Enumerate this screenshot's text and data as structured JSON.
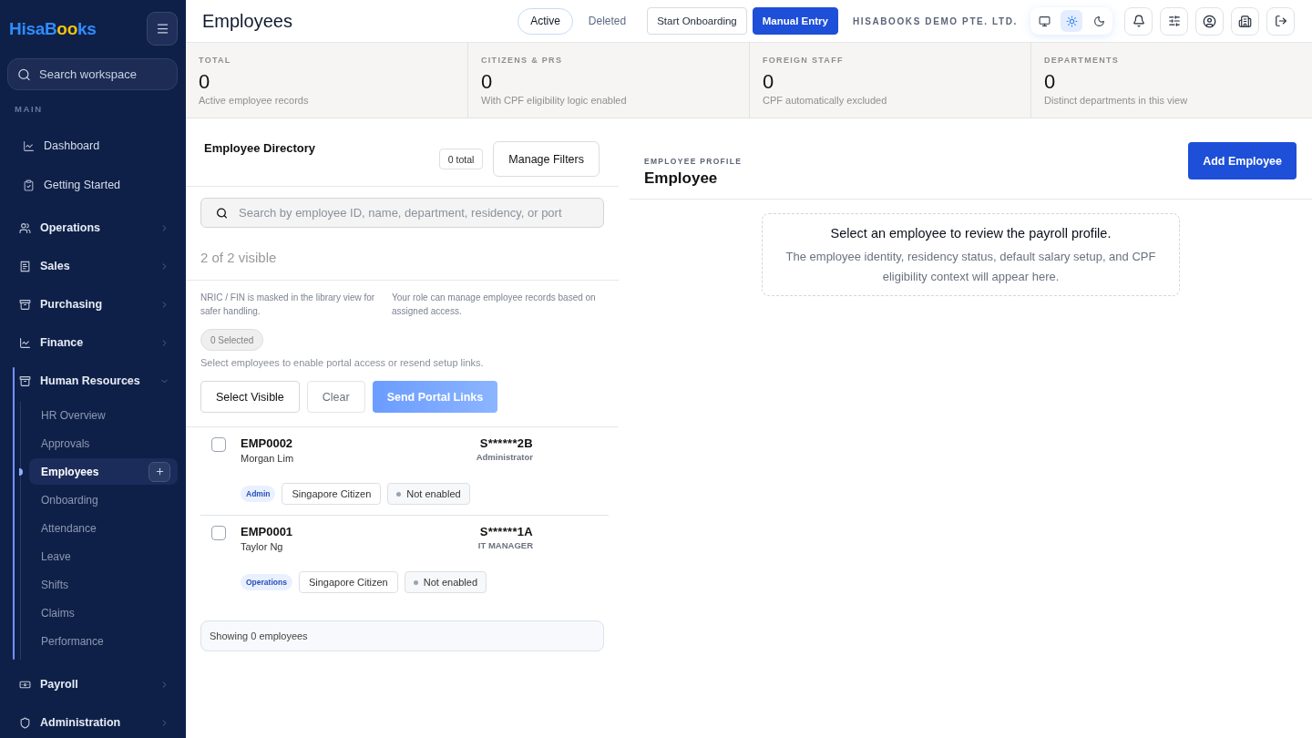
{
  "sidebar": {
    "logo": {
      "lead": "HisaB",
      "accent": "oo",
      "tail": "ks"
    },
    "search": {
      "placeholder": "Search workspace"
    },
    "section_label": "MAIN",
    "pinned": [
      {
        "label": "Dashboard"
      },
      {
        "label": "Getting Started"
      }
    ],
    "groups": [
      {
        "label": "Operations",
        "expanded": false
      },
      {
        "label": "Sales",
        "expanded": false
      },
      {
        "label": "Purchasing",
        "expanded": false
      },
      {
        "label": "Finance",
        "expanded": false
      },
      {
        "label": "Human Resources",
        "expanded": true,
        "children": [
          {
            "label": "HR Overview",
            "selected": false,
            "add_button": false
          },
          {
            "label": "Approvals",
            "selected": false,
            "add_button": false
          },
          {
            "label": "Employees",
            "selected": true,
            "add_button": true
          },
          {
            "label": "Onboarding",
            "selected": false,
            "add_button": false
          },
          {
            "label": "Attendance",
            "selected": false,
            "add_button": false
          },
          {
            "label": "Leave",
            "selected": false,
            "add_button": false
          },
          {
            "label": "Shifts",
            "selected": false,
            "add_button": false
          },
          {
            "label": "Claims",
            "selected": false,
            "add_button": false
          },
          {
            "label": "Performance",
            "selected": false,
            "add_button": false
          }
        ]
      },
      {
        "label": "Payroll",
        "expanded": false
      },
      {
        "label": "Administration",
        "expanded": false
      }
    ]
  },
  "header": {
    "title": "Employees",
    "views": [
      {
        "label": "Active",
        "selected": true
      },
      {
        "label": "Deleted",
        "selected": false
      }
    ],
    "actions": [
      {
        "label": "Start Onboarding",
        "kind": "secondary"
      },
      {
        "label": "Manual Entry",
        "kind": "primary"
      }
    ],
    "company": "HISABOOKS DEMO PTE. LTD.",
    "theme_modes": [
      {
        "kind": "system",
        "selected": false
      },
      {
        "kind": "light",
        "selected": true
      },
      {
        "kind": "dark",
        "selected": false
      }
    ]
  },
  "stats": [
    {
      "label": "TOTAL",
      "value": "0",
      "note": "Active employee records"
    },
    {
      "label": "CITIZENS & PRS",
      "value": "0",
      "note": "With CPF eligibility logic enabled"
    },
    {
      "label": "FOREIGN STAFF",
      "value": "0",
      "note": "CPF automatically excluded"
    },
    {
      "label": "DEPARTMENTS",
      "value": "0",
      "note": "Distinct departments in this view"
    }
  ],
  "directory": {
    "title": "Employee Directory",
    "total_badge": "0 total",
    "filter_button": "Manage Filters",
    "search": {
      "placeholder": "Search by employee ID, name, department, residency, or port"
    },
    "visible_count": "2 of 2 visible",
    "notes": [
      "NRIC / FIN is masked in the library view for safer handling.",
      "Your role can manage employee records based on assigned access."
    ],
    "selected_badge": "0 Selected",
    "hint": "Select employees to enable portal access or resend setup links.",
    "buttons": [
      {
        "label": "Select Visible",
        "kind": "secondary",
        "disabled": false
      },
      {
        "label": "Clear",
        "kind": "secondary",
        "disabled": true
      },
      {
        "label": "Send Portal Links",
        "kind": "primary",
        "disabled": true
      }
    ],
    "employees": [
      {
        "id": "EMP0002",
        "name": "Morgan Lim",
        "nric": "S******2B",
        "role": "Administrator",
        "checked": false,
        "department": "Admin",
        "residency": "Singapore Citizen",
        "portal": "Not enabled"
      },
      {
        "id": "EMP0001",
        "name": "Taylor Ng",
        "nric": "S******1A",
        "role": "IT MANAGER",
        "checked": false,
        "department": "Operations",
        "residency": "Singapore Citizen",
        "portal": "Not enabled"
      }
    ],
    "footer": "Showing 0 employees"
  },
  "profile": {
    "eyebrow": "EMPLOYEE PROFILE",
    "title": "Employee",
    "add_button": "Add Employee",
    "empty_title": "Select an employee to review the payroll profile.",
    "empty_text": "The employee identity, residency status, default salary setup, and CPF eligibility context will appear here."
  }
}
